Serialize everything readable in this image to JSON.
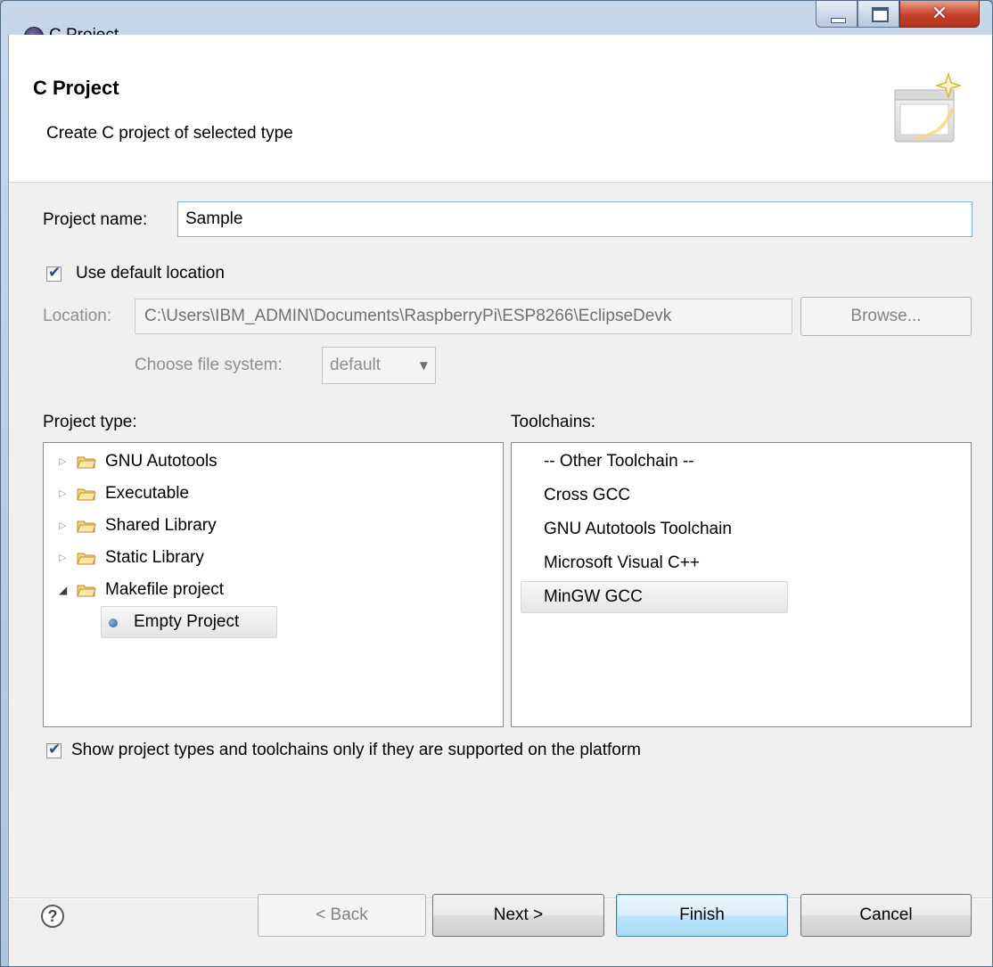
{
  "window": {
    "title": "C Project"
  },
  "header": {
    "title": "C Project",
    "subtitle": "Create C project of selected type",
    "image_icon": "wizard-banner-icon"
  },
  "form": {
    "project_name_label": "Project name:",
    "project_name_value": "Sample",
    "use_default_location_label": "Use default location",
    "use_default_location_checked": true,
    "location_label": "Location:",
    "location_value": "C:\\Users\\IBM_ADMIN\\Documents\\RaspberryPi\\ESP8266\\EclipseDevk",
    "browse_label": "Browse...",
    "file_system_label": "Choose file system:",
    "file_system_value": "default"
  },
  "project_type": {
    "label": "Project type:",
    "items": [
      {
        "label": "GNU Autotools",
        "expanded": false
      },
      {
        "label": "Executable",
        "expanded": false
      },
      {
        "label": "Shared Library",
        "expanded": false
      },
      {
        "label": "Static Library",
        "expanded": false
      },
      {
        "label": "Makefile project",
        "expanded": true,
        "children": [
          {
            "label": "Empty Project",
            "selected": true
          }
        ]
      }
    ]
  },
  "toolchains": {
    "label": "Toolchains:",
    "items": [
      {
        "label": "-- Other Toolchain --"
      },
      {
        "label": "Cross GCC"
      },
      {
        "label": "GNU Autotools Toolchain"
      },
      {
        "label": "Microsoft Visual C++"
      },
      {
        "label": "MinGW GCC",
        "selected": true
      }
    ]
  },
  "filter": {
    "label": "Show project types and toolchains only if they are supported on the platform",
    "checked": true
  },
  "buttons": {
    "help_icon": "?",
    "back": "< Back",
    "next": "Next >",
    "finish": "Finish",
    "cancel": "Cancel"
  },
  "colors": {
    "title_gradient": "#c6d7ea",
    "close_button": "#c4422a",
    "default_button": "#bee6fd",
    "dialog_bg": "#f0f0f0"
  }
}
